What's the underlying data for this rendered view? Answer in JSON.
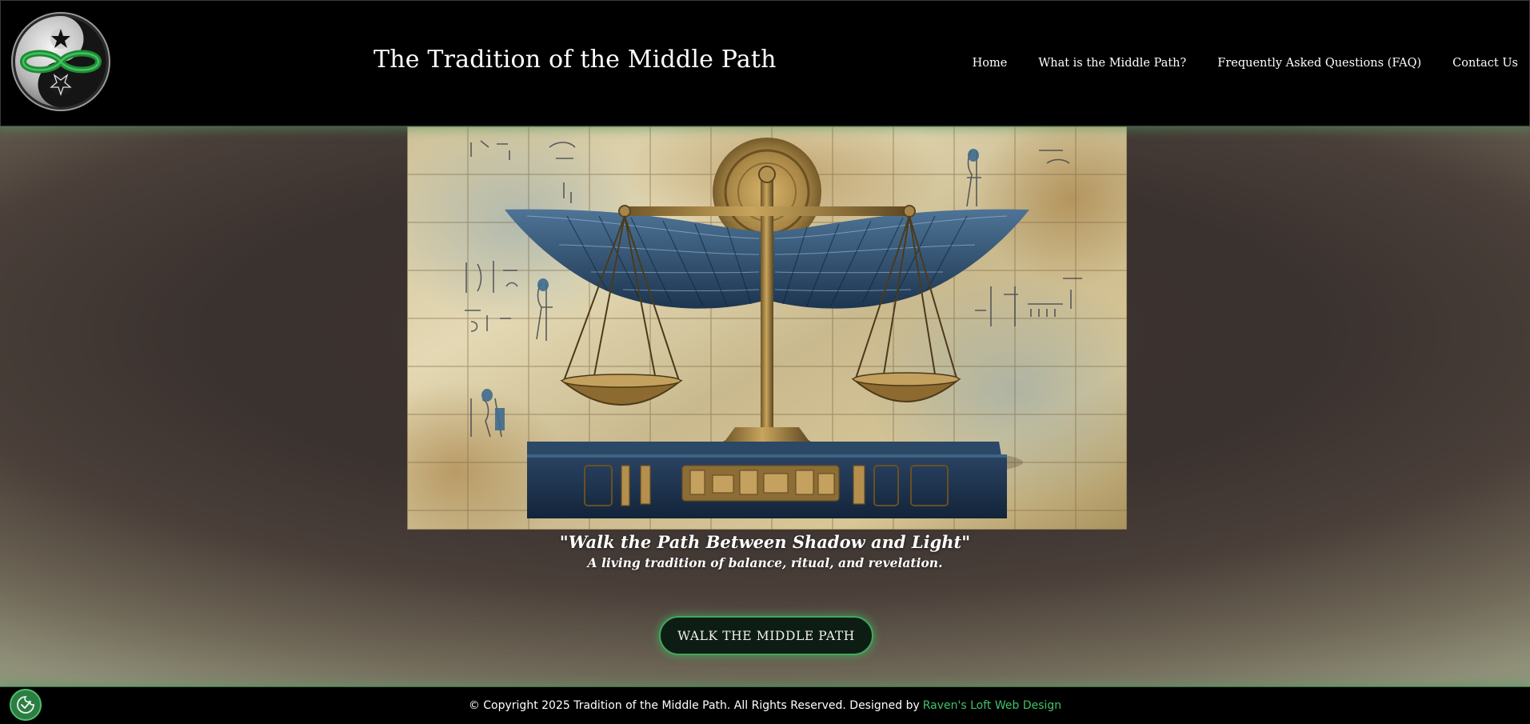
{
  "site": {
    "title": "The Tradition of the Middle Path"
  },
  "nav": {
    "items": [
      {
        "label": "Home"
      },
      {
        "label": "What is the Middle Path?"
      },
      {
        "label": "Frequently Asked Questions (FAQ)"
      },
      {
        "label": "Contact Us"
      }
    ]
  },
  "hero": {
    "tagline": "\"Walk the Path Between Shadow and Light\"",
    "subtagline": "A living tradition of balance, ritual, and revelation.",
    "cta_label": "WALK THE MIDDLE PATH"
  },
  "footer": {
    "copyright": "© Copyright 2025 Tradition of the Middle Path. All Rights Reserved. Designed by",
    "credit_link": "Raven's Loft Web Design"
  },
  "icons": {
    "logo": "yin-yang-infinity-pentagram-logo",
    "consent": "cookie-consent-checkmark-icon"
  },
  "colors": {
    "accent_green": "#41c26a",
    "header_bg": "#000000",
    "cta_bg": "#0e1d14"
  }
}
